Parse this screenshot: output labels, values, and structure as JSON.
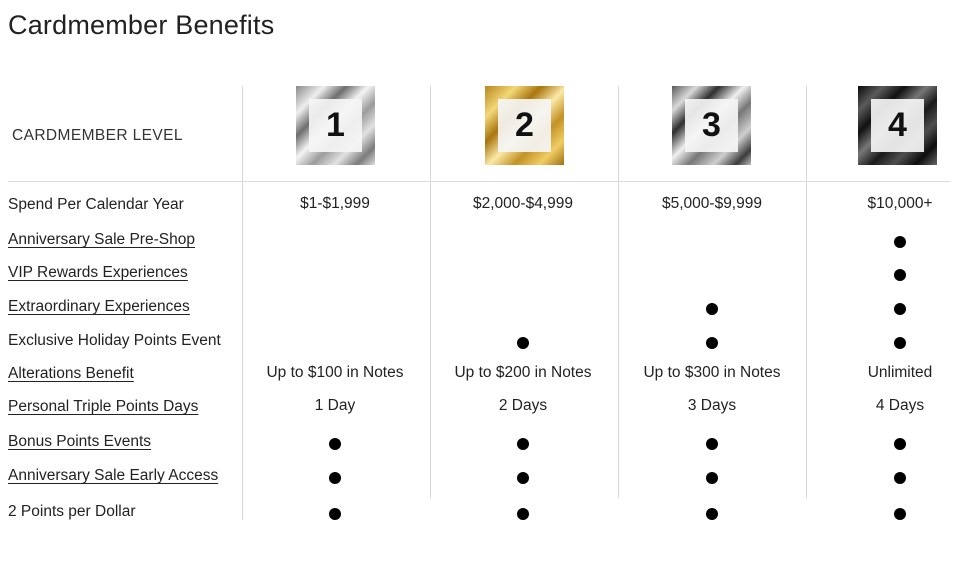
{
  "page_title": "Cardmember Benefits",
  "level_header": "CARDMEMBER LEVEL",
  "levels": [
    "1",
    "2",
    "3",
    "4"
  ],
  "rows": [
    {
      "label": "Spend Per Calendar Year",
      "link": false,
      "values": [
        "$1-$1,999",
        "$2,000-$4,999",
        "$5,000-$9,999",
        "$10,000+"
      ]
    },
    {
      "label": "Anniversary Sale Pre-Shop",
      "link": true,
      "values": [
        "",
        "",
        "",
        "●"
      ]
    },
    {
      "label": "VIP Rewards Experiences",
      "link": true,
      "values": [
        "",
        "",
        "",
        "●"
      ]
    },
    {
      "label": "Extraordinary Experiences",
      "link": true,
      "values": [
        "",
        "",
        "●",
        "●"
      ]
    },
    {
      "label": "Exclusive Holiday Points Event",
      "link": false,
      "values": [
        "",
        "●",
        "●",
        "●"
      ]
    },
    {
      "label": "Alterations Benefit",
      "link": true,
      "values": [
        "Up to $100 in Notes",
        "Up to $200 in Notes",
        "Up to $300 in Notes",
        "Unlimited"
      ]
    },
    {
      "label": "Personal Triple Points Days",
      "link": true,
      "values": [
        "1 Day",
        "2 Days",
        "3 Days",
        "4 Days"
      ]
    },
    {
      "label": "Bonus Points Events",
      "link": true,
      "values": [
        "●",
        "●",
        "●",
        "●"
      ]
    },
    {
      "label": "Anniversary Sale Early Access",
      "link": true,
      "values": [
        "●",
        "●",
        "●",
        "●"
      ]
    },
    {
      "label": "2 Points per Dollar",
      "link": false,
      "values": [
        "●",
        "●",
        "●",
        "●"
      ]
    }
  ]
}
